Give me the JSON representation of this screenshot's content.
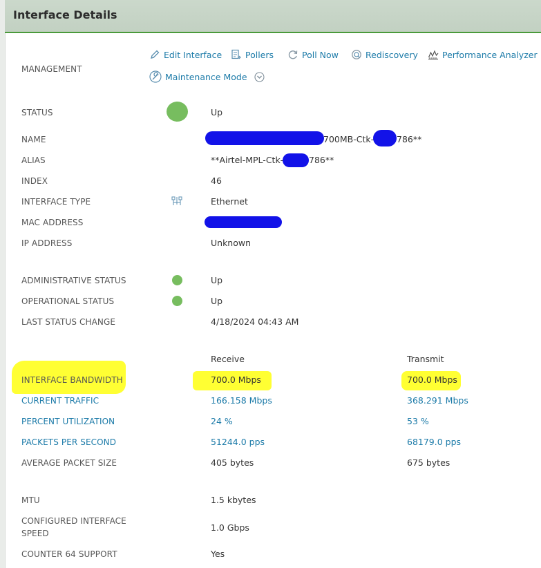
{
  "header": {
    "title": "Interface Details"
  },
  "management": {
    "label": "MANAGEMENT",
    "actions": [
      {
        "label": "Edit Interface",
        "icon": "pencil-icon"
      },
      {
        "label": "Pollers",
        "icon": "pollers-icon"
      },
      {
        "label": "Poll Now",
        "icon": "refresh-icon"
      },
      {
        "label": "Rediscovery",
        "icon": "rediscovery-icon"
      },
      {
        "label": "Performance Analyzer",
        "icon": "performance-analyzer-icon"
      }
    ],
    "maintenance": {
      "label": "Maintenance Mode",
      "icon": "wrench-icon"
    }
  },
  "details": {
    "status": {
      "label": "STATUS",
      "value": "Up"
    },
    "name": {
      "label": "NAME",
      "value_visible_a": "700MB-Ctk-",
      "value_visible_b": "786**"
    },
    "alias": {
      "label": "ALIAS",
      "value_visible_a": "**Airtel-MPL-Ctk-",
      "value_visible_b": "786**"
    },
    "index": {
      "label": "INDEX",
      "value": "46"
    },
    "interface_type": {
      "label": "INTERFACE TYPE",
      "value": "Ethernet"
    },
    "mac_address": {
      "label": "MAC ADDRESS"
    },
    "ip_address": {
      "label": "IP ADDRESS",
      "value": "Unknown"
    }
  },
  "status_block": {
    "admin": {
      "label": "ADMINISTRATIVE STATUS",
      "value": "Up"
    },
    "oper": {
      "label": "OPERATIONAL STATUS",
      "value": "Up"
    },
    "last_change": {
      "label": "LAST STATUS CHANGE",
      "value": "4/18/2024 04:43 AM"
    }
  },
  "traffic": {
    "col_receive": "Receive",
    "col_transmit": "Transmit",
    "rows": [
      {
        "label": "INTERFACE BANDWIDTH",
        "receive": "700.0 Mbps",
        "transmit": "700.0 Mbps"
      },
      {
        "label": "CURRENT TRAFFIC",
        "receive": "166.158 Mbps",
        "transmit": "368.291 Mbps"
      },
      {
        "label": "PERCENT UTILIZATION",
        "receive": "24 %",
        "transmit": "53 %"
      },
      {
        "label": "PACKETS PER SECOND",
        "receive": "51244.0 pps",
        "transmit": "68179.0 pps"
      },
      {
        "label": "AVERAGE PACKET SIZE",
        "receive": "405 bytes",
        "transmit": "675 bytes"
      }
    ]
  },
  "misc": {
    "mtu": {
      "label": "MTU",
      "value": "1.5 kbytes"
    },
    "speed": {
      "label_line1": "CONFIGURED INTERFACE",
      "label_line2": "SPEED",
      "value": "1.0 Gbps"
    },
    "counter64": {
      "label": "COUNTER 64 SUPPORT",
      "value": "Yes"
    }
  },
  "colors": {
    "status_up": "#77bd5f",
    "link": "#1b7aa8",
    "redaction": "#1212e8",
    "highlight": "#ffff33",
    "header_border": "#4a9a3a"
  }
}
